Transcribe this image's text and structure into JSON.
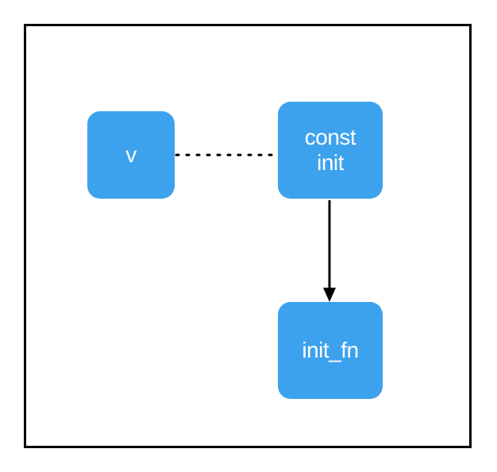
{
  "diagram": {
    "nodes": {
      "v": {
        "label": "v"
      },
      "const_init": {
        "line1": "const",
        "line2": "init"
      },
      "init_fn": {
        "label": "init_fn"
      }
    },
    "edges": [
      {
        "from": "v",
        "to": "const_init",
        "style": "dotted",
        "directed": false
      },
      {
        "from": "const_init",
        "to": "init_fn",
        "style": "solid",
        "directed": true
      }
    ],
    "colors": {
      "node_fill": "#3da2ee",
      "node_text": "#ffffff",
      "edge": "#000000",
      "frame": "#000000"
    }
  }
}
